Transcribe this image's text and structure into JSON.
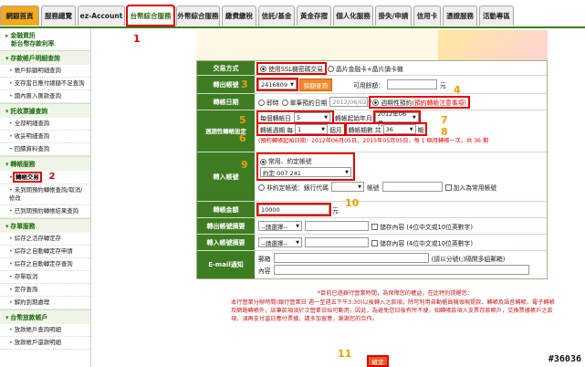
{
  "tabs": [
    {
      "label": "網銀首頁"
    },
    {
      "label": "服務總覽"
    },
    {
      "label": "ez-Account"
    },
    {
      "label": "台幣綜合服務"
    },
    {
      "label": "外幣綜合服務"
    },
    {
      "label": "繳費繳稅"
    },
    {
      "label": "信託/基金"
    },
    {
      "label": "黃金存摺"
    },
    {
      "label": "個人化服務"
    },
    {
      "label": "掛失/申請"
    },
    {
      "label": "信用卡"
    },
    {
      "label": "憑證服務"
    },
    {
      "label": "活動專區"
    }
  ],
  "sidebar": {
    "top_items": [
      "金融資訊",
      "新台幣存款利率"
    ],
    "sections": [
      {
        "head": "存款帳戶明細查詢",
        "items": [
          "帳戶餘額明細查詢",
          "支存當日應付總額不足查詢",
          "國內匯入匯款查詢"
        ]
      },
      {
        "head": "託收票據查詢",
        "items": [
          "全部明細查詢",
          "收妥明細查詢",
          "回饋資料查詢"
        ]
      },
      {
        "head": "轉帳服務",
        "items": [
          "轉帳交易",
          "未到期預約轉帳查詢/取消/修改",
          "已到期預約轉帳結果查詢"
        ]
      },
      {
        "head": "存單服務",
        "items": [
          "綜存之活存轉定存",
          "綜存之自動轉定存申請",
          "綜存之自動轉定存查詢",
          "存單取消",
          "定存查詢",
          "解約到期處理"
        ]
      },
      {
        "head": "台幣放款帳戶",
        "items": [
          "放款帳戶查詢明細",
          "放款帳戶還款明細"
        ]
      }
    ]
  },
  "form": {
    "trade_mode": {
      "label": "交易方式",
      "opt1": "使用SSL機密碼交易",
      "opt2": "晶片金融卡+晶片讀卡機"
    },
    "from_acct": {
      "label": "轉出帳號",
      "value": "2416809",
      "query": "餘額查詢",
      "balance_label": "可用餘額：",
      "unit": "元"
    },
    "date": {
      "label": "轉帳日期",
      "opt_now": "即時",
      "opt_single": "單筆預約日期",
      "single_date": "2012/06/02",
      "opt_cycle": "週期性預約",
      "cycle_note": "(預約轉帳注意事項)"
    },
    "cycle": {
      "label": "週期性轉帳設定",
      "every_month_label": "每個轉帳日",
      "day": "5",
      "start_label": "轉帳起始年月",
      "start": "2012年06月",
      "period_label": "轉帳週期",
      "period_prefix": "每",
      "period": "1",
      "period_unit": "個月",
      "count_label": "轉帳期數",
      "count_prefix": "共",
      "count": "36",
      "count_unit": "期",
      "summary": "(預約轉帳起始日期：2012年06月05日，2015年05月05日，每 1 個月轉帳一次，共 36 期"
    },
    "to_acct": {
      "label": "轉入帳號",
      "opt_common": "常用、約定帳號",
      "selected": "約定 007 241",
      "opt_other": "非約定帳號：銀行代碼",
      "acct_label": "帳號",
      "add_common": "加入為常用帳號"
    },
    "amount": {
      "label": "轉帳金額",
      "value": "10000",
      "unit": "元"
    },
    "out_note": {
      "label": "轉出帳號摘要",
      "select": "--請選擇--",
      "save": "儲存內容 (4位中文或10位英數字)"
    },
    "in_note": {
      "label": "轉入帳號摘要",
      "select": "--請選擇--",
      "save": "儲存內容 (4位中文或10位英數字)"
    },
    "email": {
      "label": "E-mail通知",
      "mail_label": "郵箱",
      "mail_hint": "(請以分號(;)隔開多組郵箱)",
      "content_label": "內容"
    }
  },
  "notes": {
    "title": "*目前已過銀行營業時間，為保障您的權益，在此特別提醒您：",
    "body": "本行營業分辦時間(銀行營業日 週一至週五下午3:30)以後轉入之款項，除可利用自動櫃員機領現提款、轉帳及語音轉帳、電子轉帳及網路轉帳外，該筆款項須於次營業日始可動用，因此，為避免您日後有所不便，如轉帳款項入支票存款帳戶，交換票據帳戶之款項，須再支付當日應付票據，請多加留意，謝謝您的合作。"
  },
  "submit_label": "確定",
  "markers": [
    "1",
    "2",
    "3",
    "4",
    "5",
    "6",
    "7",
    "8",
    "9",
    "10",
    "11"
  ],
  "watermark": "#36036"
}
